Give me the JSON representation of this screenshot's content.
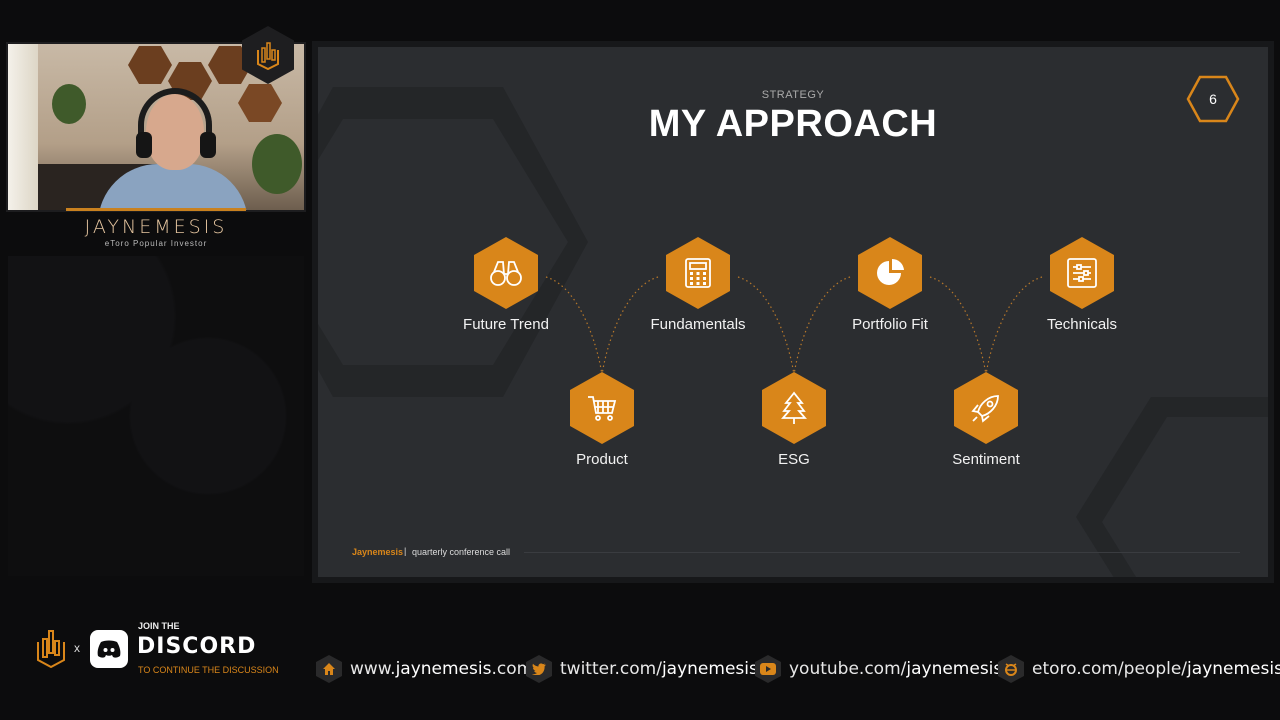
{
  "streamer": {
    "name": "JAYNEMESIS",
    "subtitle": "eToro Popular Investor"
  },
  "slide": {
    "kicker": "STRATEGY",
    "title": "MY APPROACH",
    "page_number": "6",
    "footer_brand": "Jaynemesis",
    "footer_separator": "|",
    "footer_desc": "quarterly conference call",
    "nodes_top": [
      {
        "label": "Future Trend",
        "icon": "binoculars-icon"
      },
      {
        "label": "Fundamentals",
        "icon": "calculator-icon"
      },
      {
        "label": "Portfolio Fit",
        "icon": "pie-chart-icon"
      },
      {
        "label": "Technicals",
        "icon": "sliders-icon"
      }
    ],
    "nodes_bottom": [
      {
        "label": "Product",
        "icon": "shopping-cart-icon"
      },
      {
        "label": "ESG",
        "icon": "tree-icon"
      },
      {
        "label": "Sentiment",
        "icon": "rocket-icon"
      }
    ]
  },
  "bottom": {
    "cross": "x",
    "join_label": "JOIN THE",
    "discord_word": "DISCORD",
    "discord_sub": "TO CONTINUE THE DISCUSSION",
    "links": [
      {
        "icon": "home-icon",
        "pre": "www.",
        "bold": "jaynemesis",
        "post": ".com"
      },
      {
        "icon": "twitter-icon",
        "pre": "twitter.com/",
        "bold": "jaynemesis",
        "post": ""
      },
      {
        "icon": "youtube-icon",
        "pre": "youtube.com/",
        "bold": "jaynemesis",
        "post": ""
      },
      {
        "icon": "etoro-icon",
        "pre": "etoro.com/people/",
        "bold": "jaynemesis",
        "post": ""
      }
    ]
  },
  "colors": {
    "accent": "#d9861a",
    "slide_bg": "#2b2d30",
    "page_bg": "#0c0c0d"
  }
}
